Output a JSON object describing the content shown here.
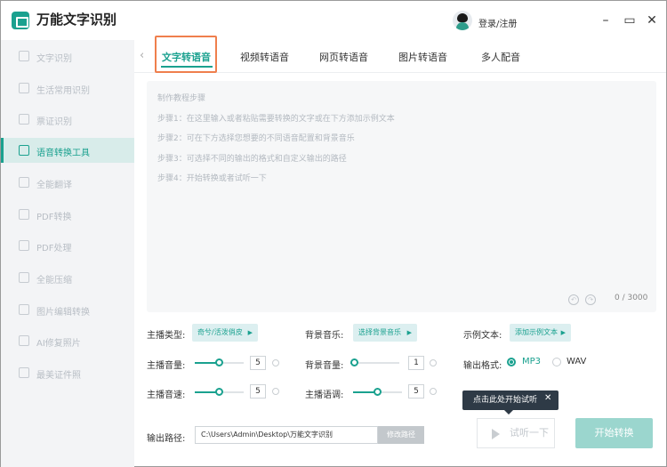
{
  "app": {
    "title": "万能文字识别",
    "login": "登录/注册"
  },
  "window": {
    "minimize_icon": "minimize-icon",
    "maximize_icon": "maximize-icon",
    "close_icon": "close-icon"
  },
  "sidebar": {
    "items": [
      {
        "label": "文字识别",
        "active": false
      },
      {
        "label": "生活常用识别",
        "active": false
      },
      {
        "label": "票证识别",
        "active": false
      },
      {
        "label": "语音转换工具",
        "active": true
      },
      {
        "label": "全能翻译",
        "active": false
      },
      {
        "label": "PDF转换",
        "active": false
      },
      {
        "label": "PDF处理",
        "active": false
      },
      {
        "label": "全能压缩",
        "active": false
      },
      {
        "label": "图片编辑转换",
        "active": false
      },
      {
        "label": "AI修复照片",
        "active": false
      },
      {
        "label": "最美证件照",
        "active": false
      }
    ]
  },
  "tabs": [
    {
      "label": "文字转语音",
      "active": true
    },
    {
      "label": "视频转语音",
      "active": false
    },
    {
      "label": "网页转语音",
      "active": false
    },
    {
      "label": "图片转语音",
      "active": false
    },
    {
      "label": "多人配音",
      "active": false
    }
  ],
  "editor": {
    "steps": [
      "制作教程步骤",
      "步骤1：在这里输入或者粘贴需要转换的文字或在下方添加示例文本",
      "步骤2：可在下方选择您想要的不同语音配置和背景音乐",
      "步骤3：可选择不同的输出的格式和自定义输出的路径",
      "步骤4：开始转换或者试听一下"
    ],
    "counter": "0 / 3000"
  },
  "settings": {
    "voice_type_label": "主播类型:",
    "voice_type_value": "奇兮/活泼俏皮",
    "bgm_label": "背景音乐:",
    "bgm_value": "选择背景音乐",
    "sample_label": "示例文本:",
    "sample_value": "添加示例文本",
    "volume_label": "主播音量:",
    "volume_value": "5",
    "volume_level": 0.5,
    "bg_volume_label": "背景音量:",
    "bg_volume_value": "1",
    "bg_volume_level": 0.0,
    "format_label": "输出格式:",
    "format_options": [
      "MP3",
      "WAV"
    ],
    "format_selected": "MP3",
    "speed_label": "主播音速:",
    "speed_value": "5",
    "speed_level": 0.5,
    "pitch_label": "主播语调:",
    "pitch_value": "5",
    "pitch_level": 0.5
  },
  "output": {
    "path_label": "输出路径:",
    "path_value": "C:\\Users\\Admin\\Desktop\\万能文字识别",
    "modify_label": "修改路径"
  },
  "tooltip": {
    "text": "点击此处开始试听"
  },
  "actions": {
    "preview_label": "试听一下",
    "start_label": "开始转换"
  },
  "colors": {
    "accent": "#1aa18f",
    "highlight_box": "#ef7f4d",
    "tooltip_bg": "#2e3a46"
  }
}
